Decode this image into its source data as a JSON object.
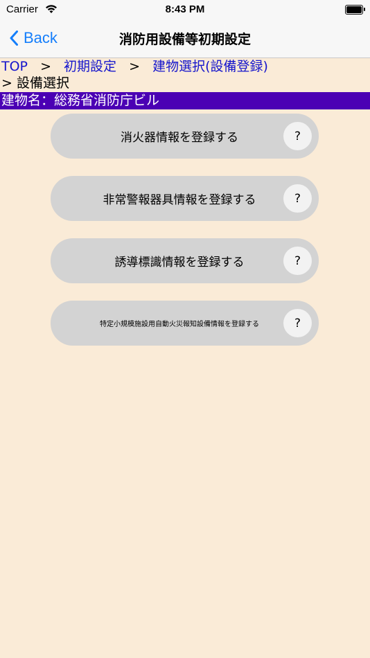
{
  "status": {
    "carrier": "Carrier",
    "time": "8:43 PM",
    "wifi_icon": "wifi-icon",
    "battery_icon": "battery-icon"
  },
  "nav": {
    "back_label": "Back",
    "back_icon": "chevron-left-icon",
    "title": "消防用設備等初期設定",
    "accent": "#147EFB"
  },
  "breadcrumb": {
    "items": [
      "TOP",
      "初期設定",
      "建物選択(設備登録)"
    ],
    "separator": ">",
    "current": "> 設備選択",
    "link_color": "#1515CC"
  },
  "building": {
    "label": "建物名：総務省消防庁ビル",
    "color": "#4B00B4"
  },
  "menu": {
    "items": [
      {
        "label": "消火器情報を登録する",
        "help": "?"
      },
      {
        "label": "非常警報器具情報を登録する",
        "help": "?"
      },
      {
        "label": "誘導標識情報を登録する",
        "help": "?"
      },
      {
        "label": "特定小規模施設用自動火災報知設備情報を登録する",
        "help": "?"
      }
    ]
  },
  "background": "#FAEBD7"
}
